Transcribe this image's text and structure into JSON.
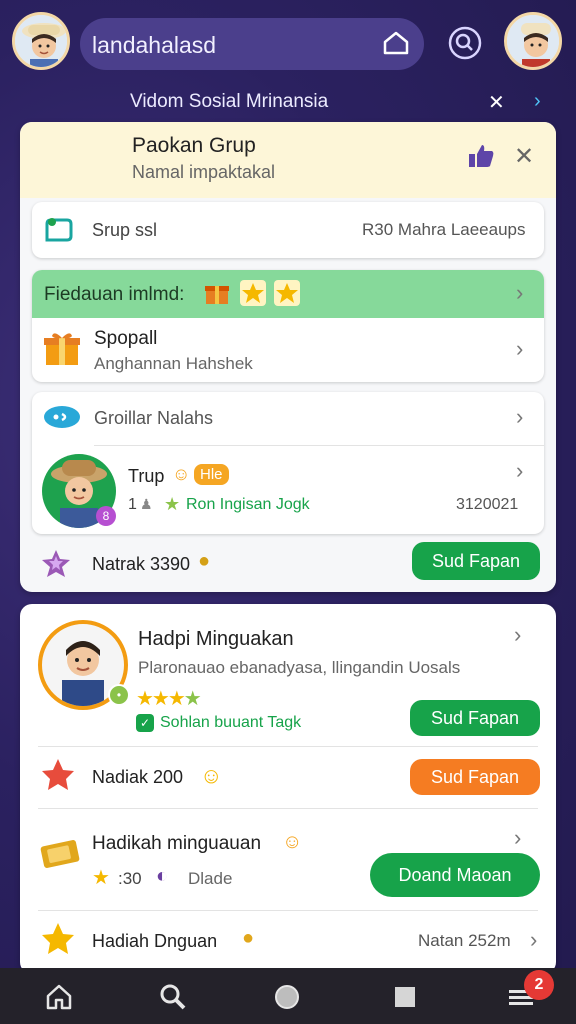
{
  "header": {
    "search_text": "landahalasd",
    "banner_title": "Vidom Sosial Mrinansia"
  },
  "group_card": {
    "title": "Paokan Grup",
    "subtitle": "Namal impaktakal",
    "grup_label": "Srup ssl",
    "grup_value": "R30 Mahra Laeeaups",
    "reward_header": "Fiedauan imlmd:",
    "special_title": "Spopall",
    "special_sub": "Anghannan Hahshek",
    "grouper_label": "Groillar Nalahs",
    "member_name": "Trup",
    "member_tag": "Hle",
    "member_count": "1",
    "member_status": "Ron Ingisan Jogk",
    "member_value": "3120021",
    "natrak_label": "Natrak 3390",
    "natrak_button": "Sud Fapan"
  },
  "rewards_card": {
    "top_title": "Hadpi Minguakan",
    "top_sub": "Plaronauao ebanadyasa, llingandin Uosals",
    "top_status": "Sohlan buuant Tagk",
    "top_button": "Sud Fapan",
    "row2_label": "Nadiak 200",
    "row2_button": "Sud Fapan",
    "row3_title": "Hadikah minguauan",
    "row3_value": ":30",
    "row3_sub": "Dlade",
    "row3_button": "Doand Maoan",
    "row4_title": "Hadiah Dnguan",
    "row4_value": "Natan 252m"
  },
  "nav": {
    "badge_count": "2"
  },
  "colors": {
    "accent_green": "#17a34a",
    "accent_orange": "#f57c22",
    "reward_header_bg": "#86d99a",
    "bg_purple": "#2b2160"
  }
}
